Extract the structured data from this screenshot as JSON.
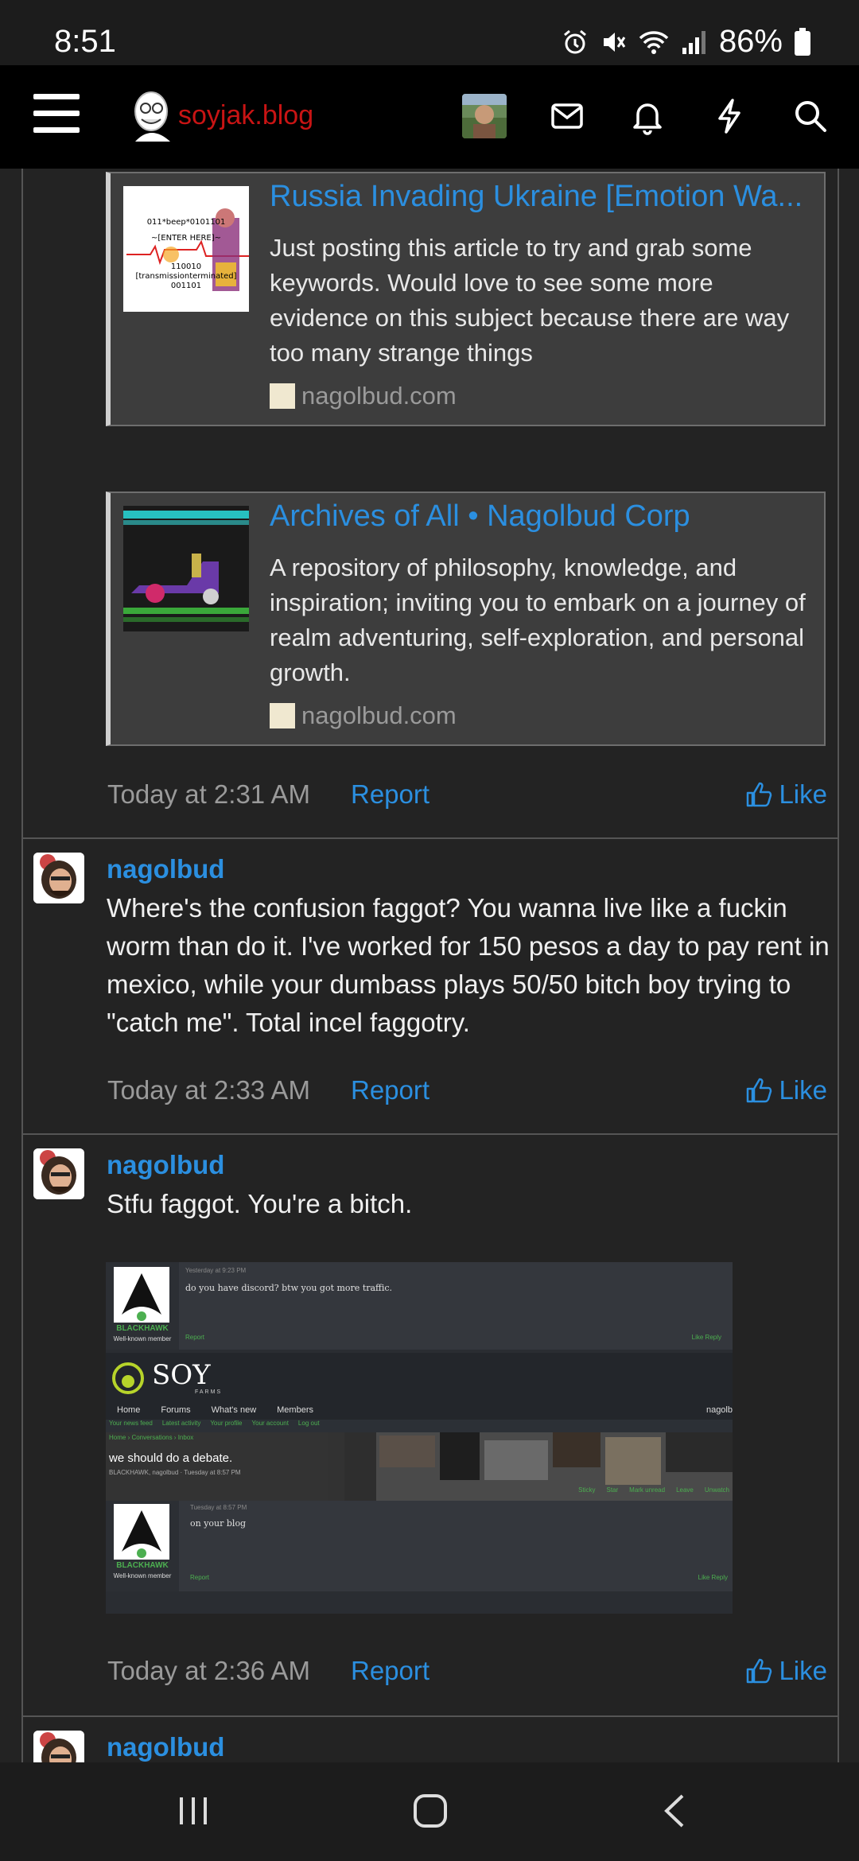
{
  "status": {
    "time": "8:51",
    "battery": "86%"
  },
  "header": {
    "site_name": "soyjak.blog",
    "icons": [
      "menu-icon",
      "mail-icon",
      "bell-icon",
      "lightning-icon",
      "search-icon"
    ]
  },
  "unfurls": [
    {
      "title": "Russia Invading Ukraine [Emotion Wa...",
      "description": "Just posting this article to try and grab some keywords. Would love to see some more evidence on this subject because there are way too many strange things",
      "domain": "nagolbud.com",
      "thumb_lines": [
        "011*beep*0101101",
        "~[ENTER HERE]~",
        "110010",
        "[transmissionterminated]",
        "001101"
      ]
    },
    {
      "title": "Archives of All • Nagolbud Corp",
      "description": "A repository of philosophy, knowledge, and inspiration; inviting you to embark on a journey of realm adventuring, self-exploration, and personal growth.",
      "domain": "nagolbud.com"
    }
  ],
  "posts": [
    {
      "time": "Today at 2:31 AM",
      "report": "Report",
      "like": "Like"
    },
    {
      "username": "nagolbud",
      "body": "Where's the confusion faggot? You wanna live like a fuckin worm than do it. I've worked for 150 pesos a day to pay rent in mexico, while your dumbass plays 50/50 bitch boy trying to \"catch me\". Total incel faggotry.",
      "time": "Today at 2:33 AM",
      "report": "Report",
      "like": "Like"
    },
    {
      "username": "nagolbud",
      "body": "Stfu faggot. You're a bitch.",
      "time": "Today at 2:36 AM",
      "report": "Report",
      "like": "Like"
    },
    {
      "username": "nagolbud"
    }
  ],
  "embedded_screenshot": {
    "top_post": {
      "time": "Yesterday at 9:23 PM",
      "text": "do you have discord? btw you got more traffic.",
      "user": "BLACKHAWK",
      "rank": "Well-known member",
      "report": "Report",
      "actions": "Like   Reply"
    },
    "site_logo": "SOY",
    "site_sub": "FARMS",
    "nav": [
      "Home",
      "Forums",
      "What's new",
      "Members"
    ],
    "nav_user": "nagolb",
    "subnav": [
      "Your news feed",
      "Latest activity",
      "Your profile",
      "Your account",
      "Log out"
    ],
    "crumbs": "Home  ›  Conversations  ›  Inbox",
    "thread_title": "we should do a debate.",
    "thread_meta": "BLACKHAWK, nagolbud · Tuesday at 8:57 PM",
    "thread_buttons": [
      "Sticky",
      "Star",
      "Mark unread",
      "Leave",
      "Unwatch"
    ],
    "bottom_post": {
      "time": "Tuesday at 8:57 PM",
      "text": "on your blog",
      "user": "BLACKHAWK",
      "rank": "Well-known member",
      "report": "Report",
      "actions": "Like   Reply"
    }
  },
  "colors": {
    "accent": "#2b8fe0",
    "site_name": "#c81414",
    "background": "#232323",
    "green": "#4caf50"
  }
}
